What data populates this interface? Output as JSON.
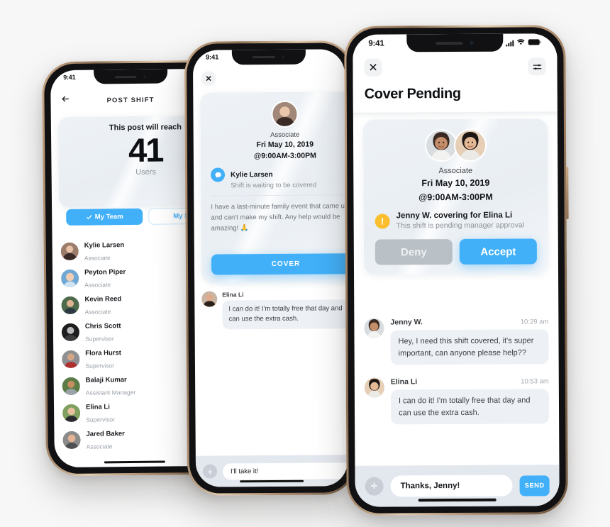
{
  "background_color": "#f7f7f7",
  "accent_color": "#41b0f8",
  "warning_color": "#fbbe2e",
  "deny_color": "#b9c0c6",
  "phone_post_shift": {
    "status_time": "9:41",
    "nav": {
      "back_icon": "arrow-left-icon",
      "title": "POST SHIFT"
    },
    "reach_card": {
      "headline": "This post will reach",
      "count": "41",
      "unit": "Users"
    },
    "segments": [
      {
        "label": "My Team",
        "selected": true,
        "icon": "check-icon"
      },
      {
        "label": "My Store",
        "selected": false
      }
    ],
    "people": [
      {
        "name": "Kylie Larsen",
        "role": "Associate"
      },
      {
        "name": "Peyton Piper",
        "role": "Associate"
      },
      {
        "name": "Kevin Reed",
        "role": "Associate"
      },
      {
        "name": "Chris Scott",
        "role": "Supervisor"
      },
      {
        "name": "Flora Hurst",
        "role": "Supervisor"
      },
      {
        "name": "Balaji Kumar",
        "role": "Assistant Manager"
      },
      {
        "name": "Elina Li",
        "role": "Supervisor"
      },
      {
        "name": "Jared Baker",
        "role": "Associate"
      }
    ]
  },
  "phone_cover_request": {
    "status_time": "9:41",
    "close_label": "✕",
    "shift_card": {
      "role": "Associate",
      "date": "Fri May 10, 2019",
      "time": "@9:00AM-3:00PM",
      "requester": "Kylie Larsen",
      "status": "Shift is waiting to be covered",
      "note": "I have a last-minute family event that came up and can't make my shift. Any help would be amazing! 🙏",
      "cover_label": "COVER"
    },
    "messages": [
      {
        "sender": "Elina Li",
        "text": "I can do it! I'm totally free that day and can use the extra cash."
      }
    ],
    "composer": {
      "add_icon": "plus-icon",
      "value": "I'll take it!"
    }
  },
  "phone_cover_pending": {
    "status_time": "9:41",
    "status_icons": [
      "signal-icon",
      "wifi-icon",
      "battery-icon"
    ],
    "header": {
      "close_label": "✕",
      "filter_icon": "sliders-icon",
      "title": "Cover Pending"
    },
    "shift_card": {
      "role": "Associate",
      "date": "Fri May 10, 2019",
      "time": "@9:00AM-3:00PM",
      "status_headline": "Jenny W. covering for Elina Li",
      "status_note": "This shift is pending manager approval",
      "warning_glyph": "!",
      "deny_label": "Deny",
      "accept_label": "Accept"
    },
    "messages": [
      {
        "sender": "Jenny W.",
        "time": "10:29 am",
        "text": "Hey, I need this shift covered, it's super important, can anyone please help??"
      },
      {
        "sender": "Elina Li",
        "time": "10:53 am",
        "text": "I can do it! I'm totally free that day and can use the extra cash."
      }
    ],
    "composer": {
      "add_icon": "plus-icon",
      "value": "Thanks, Jenny!",
      "send_label": "SEND"
    }
  }
}
